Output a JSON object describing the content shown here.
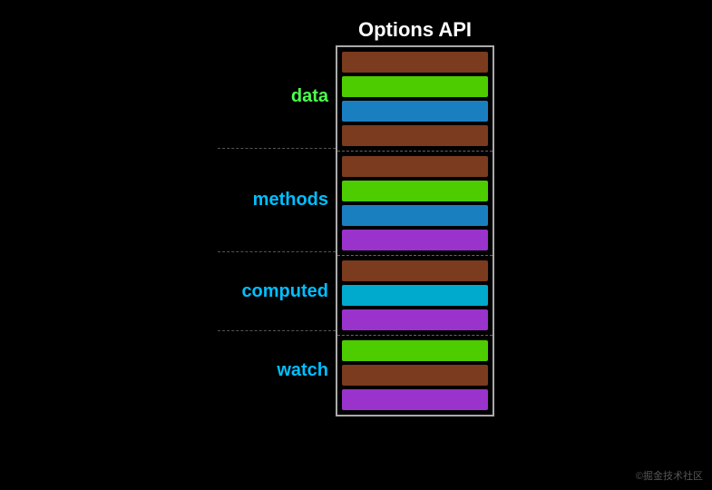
{
  "title": "Options API",
  "watermark": "©掘金技术社区",
  "sections": [
    {
      "label": "data",
      "labelColor": "#4dff4d",
      "bars": [
        {
          "color": "#7a3b1e"
        },
        {
          "color": "#4dcc00"
        },
        {
          "color": "#1a7fbf"
        },
        {
          "color": "#7a3b1e"
        }
      ]
    },
    {
      "label": "methods",
      "labelColor": "#00bfff",
      "bars": [
        {
          "color": "#7a3b1e"
        },
        {
          "color": "#4dcc00"
        },
        {
          "color": "#1a7fbf"
        },
        {
          "color": "#9933cc"
        }
      ]
    },
    {
      "label": "computed",
      "labelColor": "#00bfff",
      "bars": [
        {
          "color": "#7a3b1e"
        },
        {
          "color": "#00aacc"
        },
        {
          "color": "#9933cc"
        }
      ]
    },
    {
      "label": "watch",
      "labelColor": "#00bfff",
      "bars": [
        {
          "color": "#4dcc00"
        },
        {
          "color": "#7a3b1e"
        },
        {
          "color": "#9933cc"
        }
      ]
    }
  ]
}
